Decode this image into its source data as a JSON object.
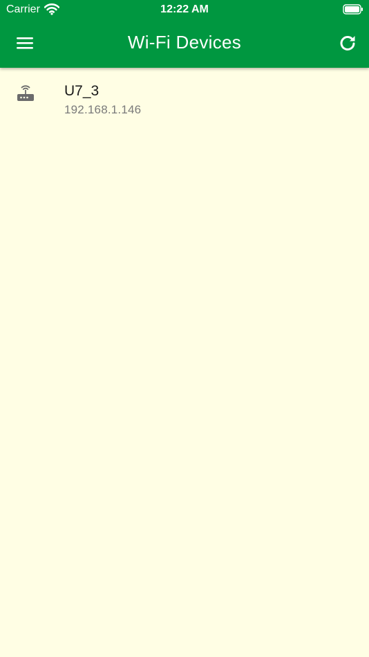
{
  "status_bar": {
    "carrier": "Carrier",
    "time": "12:22 AM",
    "wifi_icon": "wifi-signal-icon",
    "battery_icon": "battery-full-icon"
  },
  "header": {
    "title": "Wi-Fi Devices",
    "menu_icon": "hamburger-menu-icon",
    "refresh_icon": "refresh-icon"
  },
  "devices": [
    {
      "icon": "router-icon",
      "name": "U7_3",
      "ip": "192.168.1.146"
    }
  ],
  "colors": {
    "header_bg": "#009740",
    "page_bg": "#FFFEE4",
    "primary_text": "#1a1a1a",
    "secondary_text": "#7a7a7a",
    "icon_gray": "#6b6b6b"
  }
}
